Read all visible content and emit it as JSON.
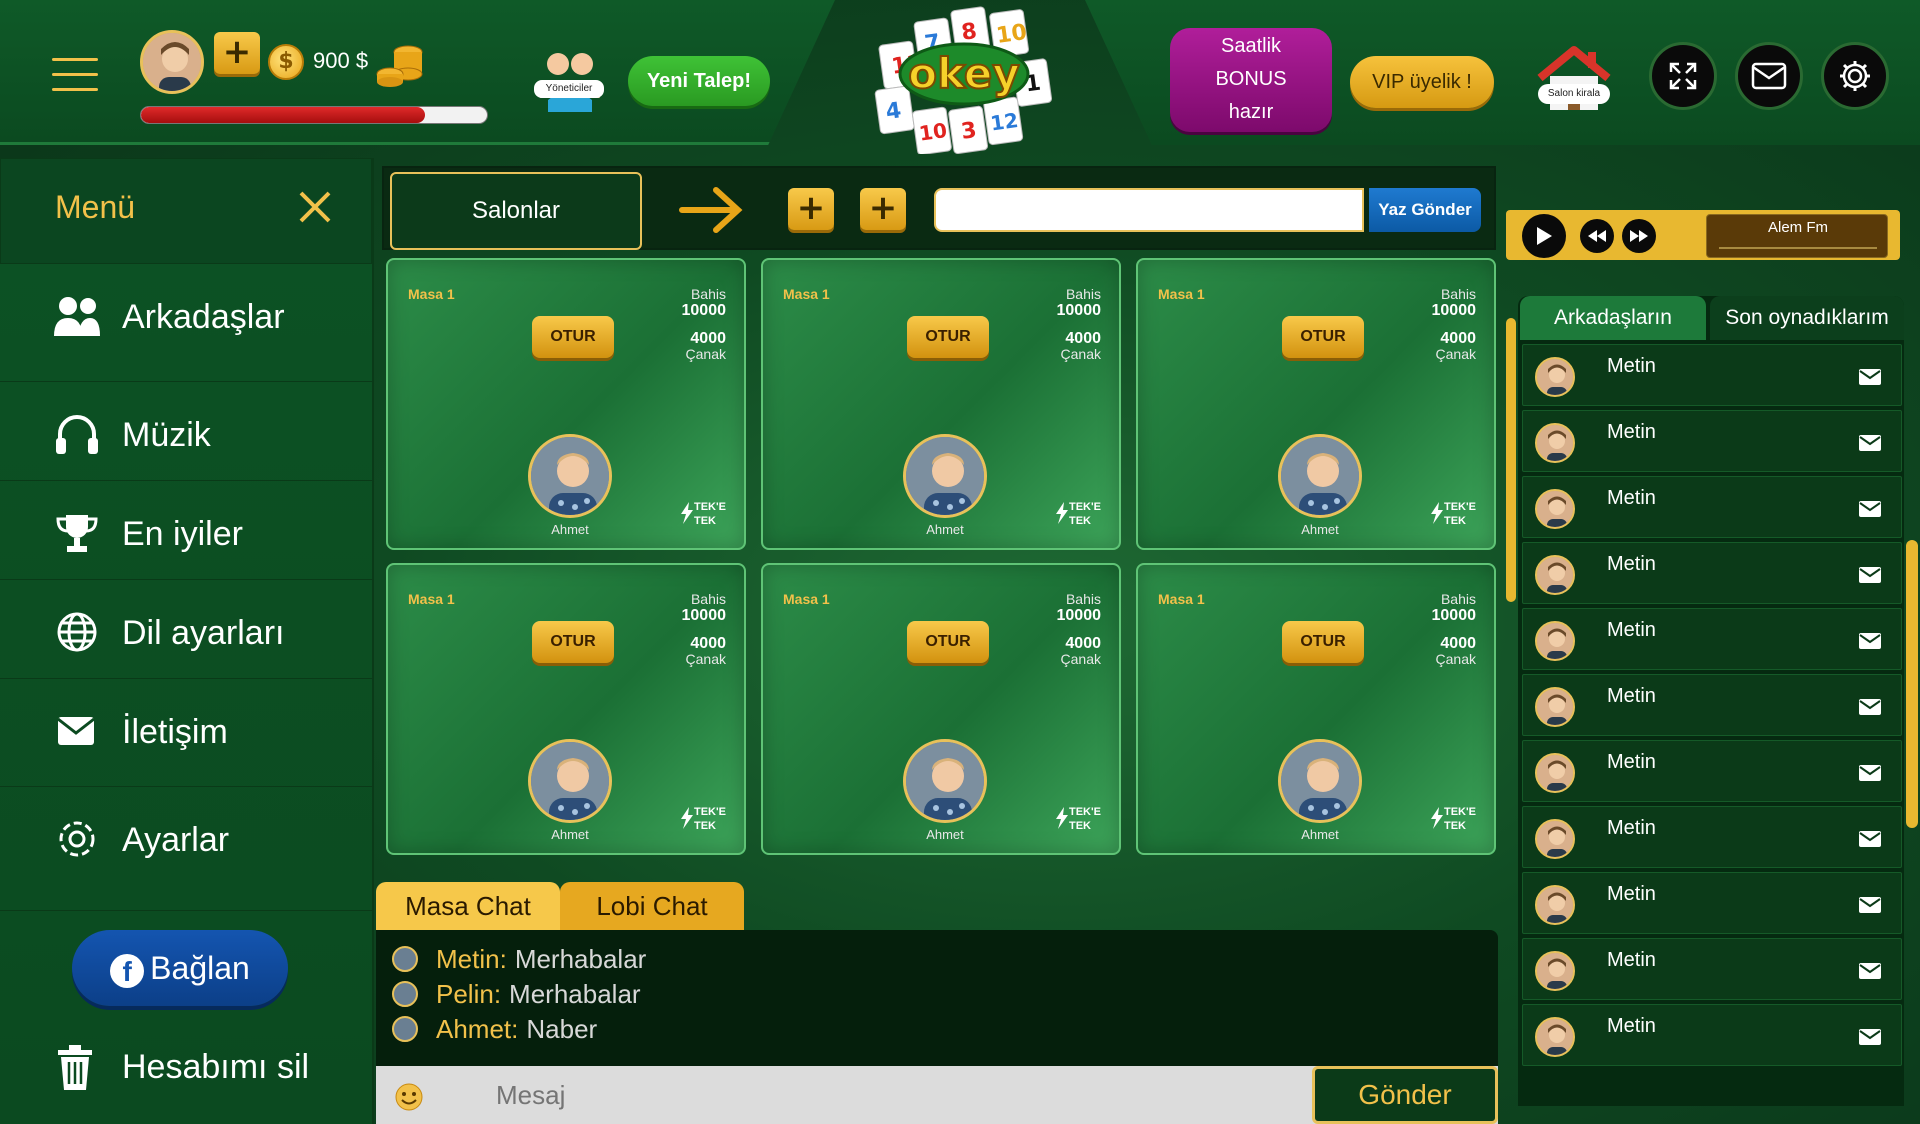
{
  "topbar": {
    "money": "900 $",
    "xp_progress": 0.82,
    "admins_label": "Yöneticiler",
    "new_request_label": "Yeni Talep!",
    "logo_text": "okey",
    "bonus_label_1": "Saatlik",
    "bonus_label_2": "BONUS",
    "bonus_label_3": "hazır",
    "vip_label": "VIP üyelik !",
    "rent_salon_label": "Salon kirala"
  },
  "menu": {
    "title": "Menü",
    "items": [
      {
        "label": "Arkadaşlar",
        "icon": "users-icon"
      },
      {
        "label": "Müzik",
        "icon": "headphones-icon"
      },
      {
        "label": "En iyiler",
        "icon": "trophy-icon"
      },
      {
        "label": "Dil ayarları",
        "icon": "globe-icon"
      },
      {
        "label": "İletişim",
        "icon": "envelope-icon"
      },
      {
        "label": "Ayarlar",
        "icon": "gear-icon"
      }
    ],
    "facebook_label": "Bağlan",
    "delete_label": "Hesabımı sil"
  },
  "toolbar": {
    "salons_label": "Salonlar",
    "message_value": "",
    "send_label": "Yaz Gönder"
  },
  "tables": [
    {
      "name": "Masa 1",
      "bet_label": "Bahis",
      "bet": "10000",
      "pot": "4000",
      "pot_label": "Çanak",
      "sit_label": "OTUR",
      "player": "Ahmet",
      "mode_1": "TEK'E",
      "mode_2": "TEK"
    },
    {
      "name": "Masa 1",
      "bet_label": "Bahis",
      "bet": "10000",
      "pot": "4000",
      "pot_label": "Çanak",
      "sit_label": "OTUR",
      "player": "Ahmet",
      "mode_1": "TEK'E",
      "mode_2": "TEK"
    },
    {
      "name": "Masa 1",
      "bet_label": "Bahis",
      "bet": "10000",
      "pot": "4000",
      "pot_label": "Çanak",
      "sit_label": "OTUR",
      "player": "Ahmet",
      "mode_1": "TEK'E",
      "mode_2": "TEK"
    },
    {
      "name": "Masa 1",
      "bet_label": "Bahis",
      "bet": "10000",
      "pot": "4000",
      "pot_label": "Çanak",
      "sit_label": "OTUR",
      "player": "Ahmet",
      "mode_1": "TEK'E",
      "mode_2": "TEK"
    },
    {
      "name": "Masa 1",
      "bet_label": "Bahis",
      "bet": "10000",
      "pot": "4000",
      "pot_label": "Çanak",
      "sit_label": "OTUR",
      "player": "Ahmet",
      "mode_1": "TEK'E",
      "mode_2": "TEK"
    },
    {
      "name": "Masa 1",
      "bet_label": "Bahis",
      "bet": "10000",
      "pot": "4000",
      "pot_label": "Çanak",
      "sit_label": "OTUR",
      "player": "Ahmet",
      "mode_1": "TEK'E",
      "mode_2": "TEK"
    }
  ],
  "chat": {
    "tabs": [
      "Masa Chat",
      "Lobi Chat"
    ],
    "messages": [
      {
        "who": "Metin:",
        "text": "Merhabalar"
      },
      {
        "who": "Pelin:",
        "text": "Merhabalar"
      },
      {
        "who": "Ahmet:",
        "text": "Naber"
      }
    ],
    "placeholder": "Mesaj",
    "send_label": "Gönder"
  },
  "radio": {
    "station": "Alem Fm"
  },
  "friends": {
    "tabs": [
      "Arkadaşların",
      "Son oynadıklarım"
    ],
    "list": [
      "Metin",
      "Metin",
      "Metin",
      "Metin",
      "Metin",
      "Metin",
      "Metin",
      "Metin",
      "Metin",
      "Metin",
      "Metin"
    ]
  },
  "colors": {
    "accent_gold": "#f2c14a",
    "felt_green": "#1b7035",
    "bonus_purple": "#b01e9a",
    "facebook_blue": "#1455b0"
  }
}
